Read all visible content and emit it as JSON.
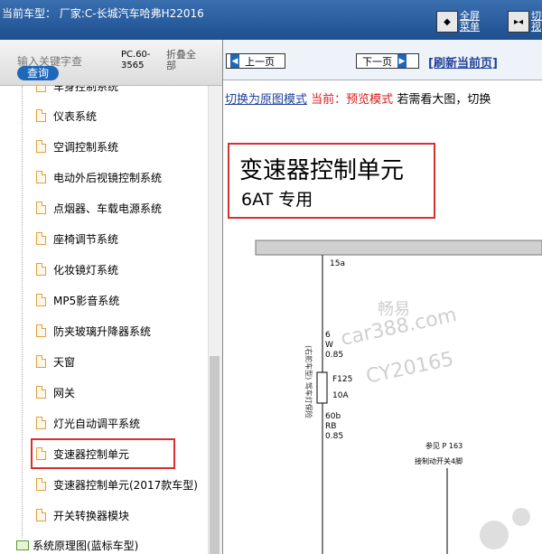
{
  "topbar": {
    "car_label": "当前车型：  厂家:C-长城汽车哈弗H22016",
    "fullscreen_label": "全屏菜单",
    "view_label": "切换视"
  },
  "sidebar": {
    "search_placeholder": "输入关键字查",
    "query_label": "查询",
    "pc_label": "PC.60-3565",
    "collapse_label": "折叠全部",
    "cut_off_item": "车身控制系统",
    "items": [
      {
        "label": "仪表系统"
      },
      {
        "label": "空调控制系统"
      },
      {
        "label": "电动外后视镜控制系统"
      },
      {
        "label": "点烟器、车载电源系统"
      },
      {
        "label": "座椅调节系统"
      },
      {
        "label": "化妆镜灯系统"
      },
      {
        "label": "MP5影音系统"
      },
      {
        "label": "防夹玻璃升降器系统"
      },
      {
        "label": "天窗"
      },
      {
        "label": "网关"
      },
      {
        "label": "灯光自动调平系统"
      },
      {
        "label": "变速器控制单元"
      },
      {
        "label": "变速器控制单元(2017款车型)"
      },
      {
        "label": "开关转换器模块"
      }
    ],
    "folder_item": "系统原理图(蓝标车型)"
  },
  "content": {
    "prev_label": "上一页",
    "next_label": "下一页",
    "refresh_label": "[刷新当前页]",
    "switch_mode_label": "切换为原图模式",
    "current_mode_label": "当前：预览模式",
    "hint_text": "若需看大图，切换",
    "doc_title": "变速器控制单元",
    "doc_subtitle": "6AT 专用",
    "diagram": {
      "wire_top": "15a",
      "wire_mid_1": "6",
      "wire_mid_2": "W",
      "wire_mid_3": "0.85",
      "fuse_name": "F125",
      "fuse_rating": "10A",
      "side_note": "(右舵车型) 驾车灯保险",
      "wire_low_1": "60b",
      "wire_low_2": "RB",
      "wire_low_3": "0.85",
      "ref_1": "参见 P 163",
      "ref_2": "接制动开关4脚",
      "watermark_1": "畅易",
      "watermark_2": "car388.com",
      "watermark_3": "CY20165"
    }
  }
}
